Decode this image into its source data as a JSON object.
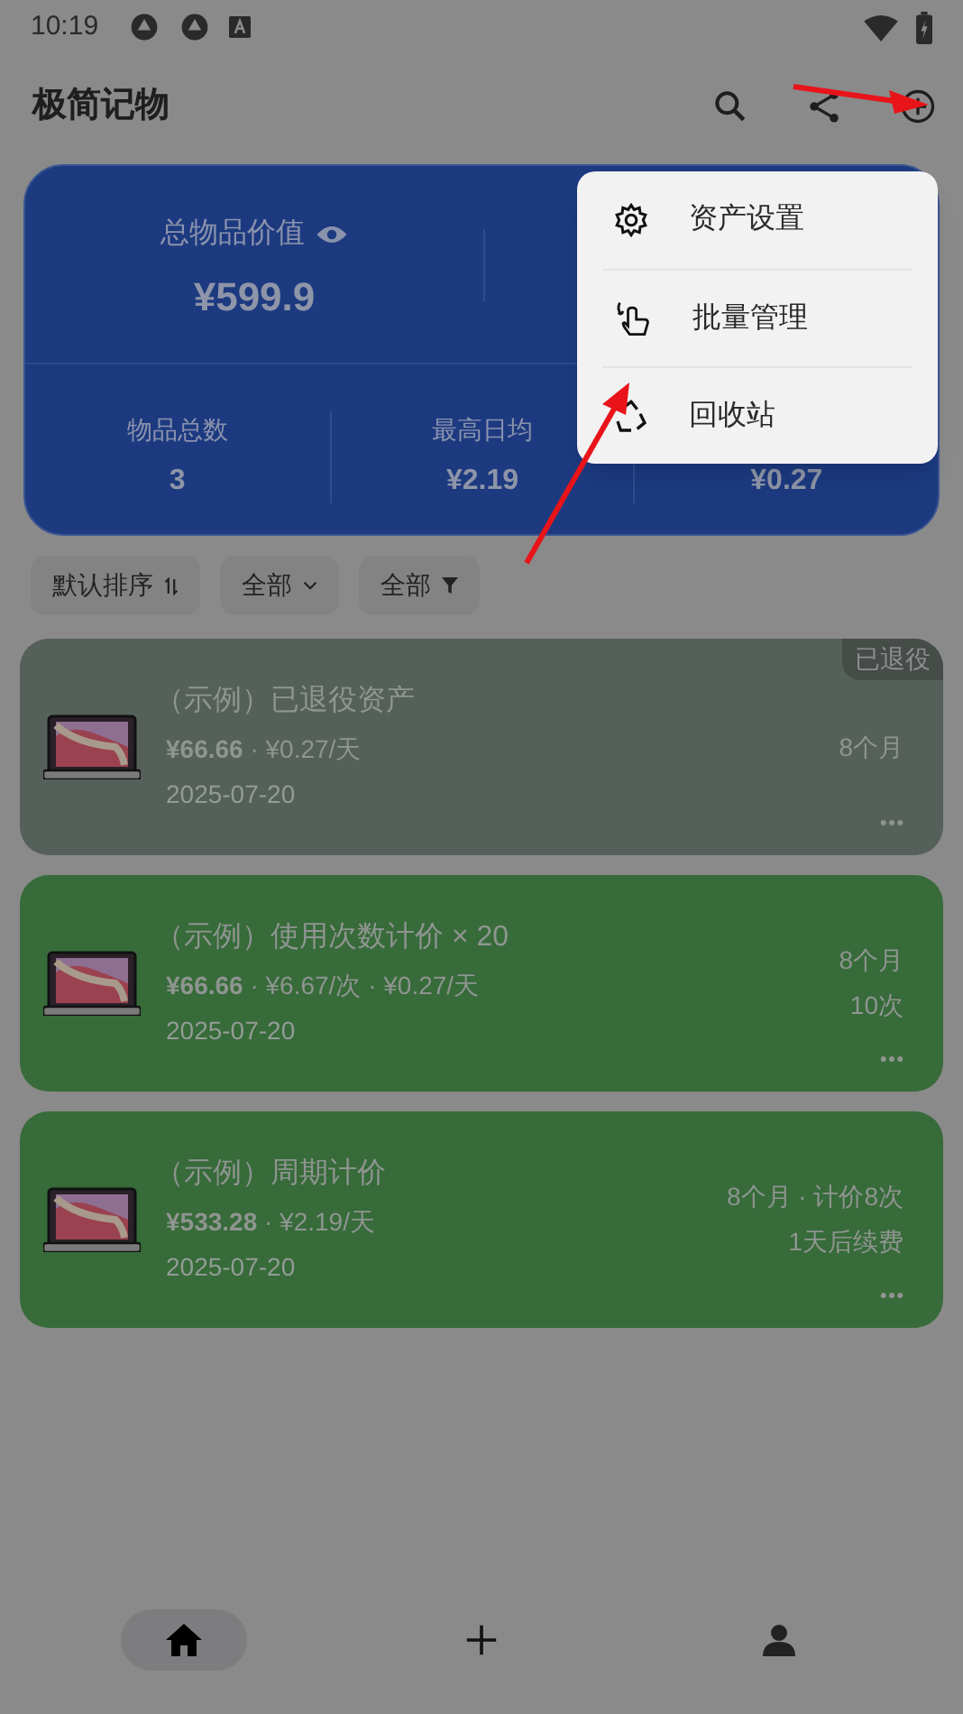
{
  "status_bar": {
    "time": "10:19"
  },
  "app_bar": {
    "title": "极简记物"
  },
  "summary": {
    "total_label": "总物品价值",
    "total_value": "¥599.9",
    "stats": [
      {
        "label": "物品总数",
        "value": "3"
      },
      {
        "label": "最高日均",
        "value": "¥2.19"
      },
      {
        "value": "¥0.27"
      }
    ]
  },
  "filters": [
    {
      "label": "默认排序",
      "kind": "sort"
    },
    {
      "label": "全部",
      "kind": "dropdown"
    },
    {
      "label": "全部",
      "kind": "filter"
    }
  ],
  "items": [
    {
      "title": "（示例）已退役资产",
      "price": "**¥66.66** · ¥0.27/天",
      "date": "2025-07-20",
      "right_lines": [
        "8个月"
      ],
      "badge": "已退役",
      "color": "#56605a"
    },
    {
      "title": "（示例）使用次数计价 × 20",
      "price": "**¥66.66** · ¥6.67/次 · ¥0.27/天",
      "date": "2025-07-20",
      "right_lines": [
        "8个月",
        "10次"
      ],
      "color": "#376b3a"
    },
    {
      "title": "（示例）周期计价",
      "price": "**¥533.28** · ¥2.19/天",
      "date": "2025-07-20",
      "right_lines": [
        "8个月 · 计价8次",
        "1天后续费"
      ],
      "color": "#376b3a"
    }
  ],
  "menu": {
    "items": [
      {
        "label": "资产设置",
        "kind": "settings"
      },
      {
        "label": "批量管理",
        "kind": "batch"
      },
      {
        "label": "回收站",
        "kind": "recycle"
      }
    ]
  },
  "bottom_nav": [
    {
      "kind": "home",
      "selected": true
    },
    {
      "kind": "add",
      "selected": false
    },
    {
      "kind": "person",
      "selected": false
    }
  ]
}
